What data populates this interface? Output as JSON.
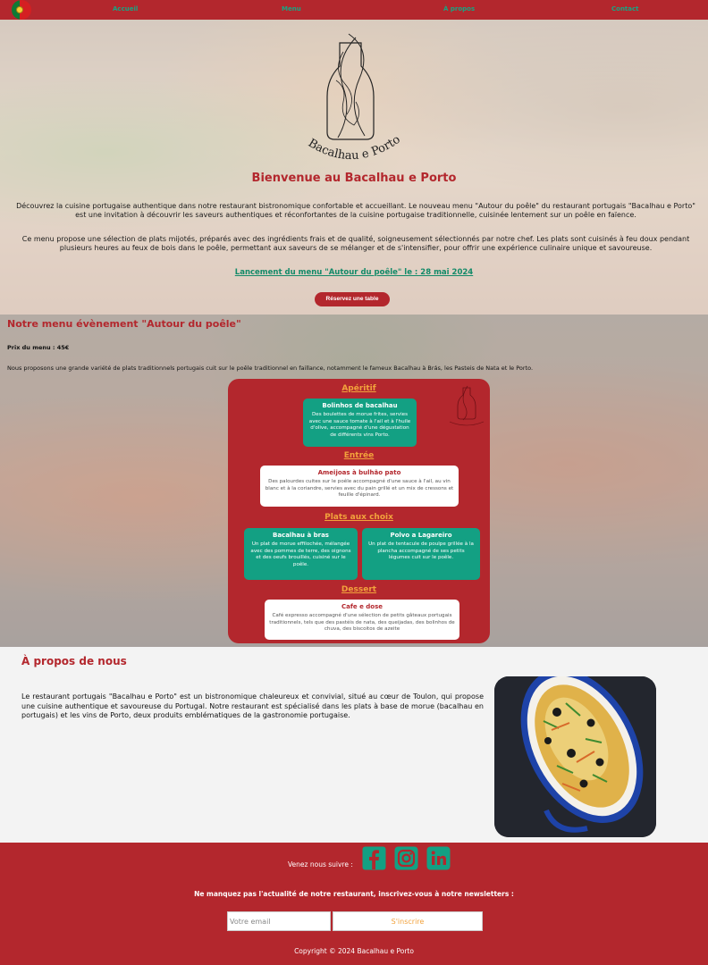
{
  "nav": {
    "links": [
      "Accueil",
      "Menu",
      "À propos",
      "Contact"
    ]
  },
  "hero": {
    "logo_text": "Bacalhau e Porto",
    "title": "Bienvenue au Bacalhau e Porto",
    "paragraph1": "Découvrez la cuisine portugaise authentique dans notre restaurant bistronomique confortable et accueillant. Le nouveau menu \"Autour du poêle\" du restaurant portugais \"Bacalhau e Porto\" est une invitation à découvrir les saveurs authentiques et réconfortantes de la cuisine portugaise traditionnelle, cuisinée lentement sur un poêle en faïence.",
    "paragraph2": "Ce menu propose une sélection de plats mijotés, préparés avec des ingrédients frais et de qualité, soigneusement sélectionnés par notre chef. Les plats sont cuisinés à feu doux pendant plusieurs heures au feux de bois dans le poêle, permettant aux saveurs de se mélanger et de s'intensifier, pour offrir une expérience culinaire unique et savoureuse.",
    "launch": "Lancement du menu \"Autour du poêle\" le : 28 mai 2024",
    "reserve_button": "Réservez une table"
  },
  "menu": {
    "title": "Notre menu évènement \"Autour du poêle\"",
    "price": "Prix du menu : 45€",
    "intro": "Nous proposons une grande variété de plats traditionnels portugais cuit sur le poêle traditionnel en faillance, notamment le fameux Bacalhau à Brás, les Pasteis de Nata et le Porto.",
    "categories": {
      "aperitif": "Apéritif",
      "entree": "Entrée",
      "plats": "Plats aux choix",
      "dessert": "Dessert"
    },
    "dishes": {
      "bolinhos": {
        "name": "Bolinhos de bacalhau",
        "desc": "Des boulettes de morue frites, servies avec une sauce tomate à l'ail et à l'huile d'olive, accompagné d'une dégustation de différents vins Porto."
      },
      "ameijoas": {
        "name": "Ameijoas à bulhão pato",
        "desc": "Des palourdes cuites sur le poêle accompagné d'une sauce à l'ail, au vin blanc et à la coriandre, servies avec du pain grillé et un mix de cressons et feuille d'épinard."
      },
      "bacalhau_bras": {
        "name": "Bacalhau à bras",
        "desc": "Un plat de morue effilochée, mélangée avec des pommes de terre, des oignons et des oeufs brouillés, cuisiné sur le poêle."
      },
      "polvo": {
        "name": "Polvo a Lagareiro",
        "desc": "Un plat de tentacule de poulpe grillée à la plancha accompagné de ses petits légumes cuit sur le poêle."
      },
      "cafe": {
        "name": "Cafe e dose",
        "desc": "Café expresso accompagné d'une sélection de petits gâteaux portugais traditionnels, tels que des pastéis de nata, des queijadas, des bolinhos de chuva, des biscoitos de azeite"
      }
    }
  },
  "about": {
    "title": "À propos de nous",
    "text": "Le restaurant portugais \"Bacalhau e Porto\" est un bistronomique chaleureux et convivial, situé au cœur de Toulon, qui propose une cuisine authentique et savoureuse du Portugal. Notre restaurant est spécialisé dans les plats à base de morue (bacalhau en portugais) et les vins de Porto, deux produits emblématiques de la gastronomie portugaise."
  },
  "footer": {
    "follow": "Venez nous suivre :",
    "newsletter": "Ne manquez pas l'actualité de notre restaurant, inscrivez-vous à notre newsletters :",
    "email_placeholder": "Votre email",
    "subscribe": "S'inscrire",
    "copyright": "Copyright © 2024 Bacalhau e Porto"
  },
  "icons": {
    "flag": "portugal-flag-icon",
    "social": [
      "facebook-icon",
      "instagram-icon",
      "linkedin-icon"
    ]
  },
  "colors": {
    "brand_red": "#b3272d",
    "accent_green": "#13a083",
    "accent_orange": "#f2a23c"
  }
}
